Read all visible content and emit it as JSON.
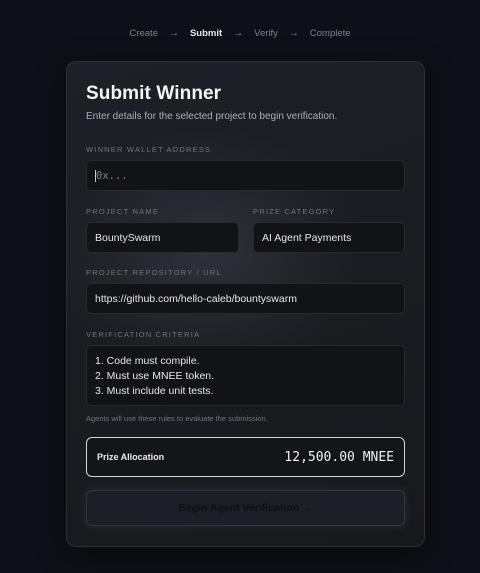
{
  "stepper": {
    "steps": [
      "Create",
      "Submit",
      "Verify",
      "Complete"
    ],
    "arrow": "→"
  },
  "form": {
    "title": "Submit Winner",
    "subtitle": "Enter details for the selected project to begin verification.",
    "wallet": {
      "label": "WINNER WALLET ADDRESS",
      "placeholder": "0x..."
    },
    "project_name": {
      "label": "PROJECT NAME",
      "value": "BountySwarm"
    },
    "prize_category": {
      "label": "PRIZE CATEGORY",
      "value": "AI Agent Payments"
    },
    "repo": {
      "label": "PROJECT REPOSITORY / URL",
      "value": "https://github.com/hello-caleb/bountyswarm"
    },
    "criteria": {
      "label": "VERIFICATION CRITERIA",
      "lines": [
        "1. Code must compile.",
        "2. Must use MNEE token.",
        "3. Must include unit tests."
      ],
      "hint": "Agents will use these rules to evaluate the submission."
    },
    "prize": {
      "label": "Prize Allocation",
      "value": "12,500.00 MNEE"
    },
    "submit_label": "Begin Agent Verification →"
  },
  "colors": {
    "background": "#0d1016",
    "card": "#1b1d22",
    "accent_glow": "#4a9696"
  }
}
